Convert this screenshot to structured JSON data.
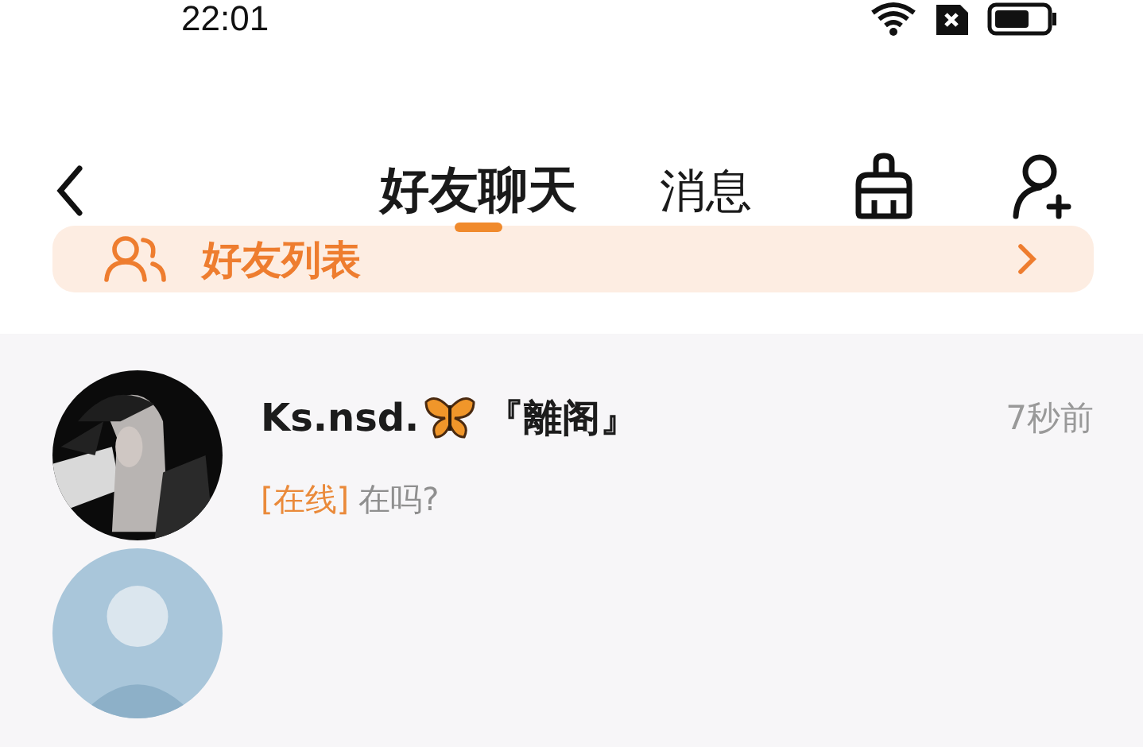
{
  "status_bar": {
    "time": "22:01"
  },
  "tabs": [
    {
      "label": "好友聊天",
      "selected": true
    },
    {
      "label": "消息",
      "selected": false
    }
  ],
  "friends_list": {
    "label": "好友列表"
  },
  "conversations": [
    {
      "kind": "chat",
      "name_start": "Ks.nsd.",
      "name_end": "『離阁』",
      "time": "7秒前",
      "status": "[在线]",
      "message": "在吗?"
    },
    {
      "kind": "partial"
    }
  ]
}
